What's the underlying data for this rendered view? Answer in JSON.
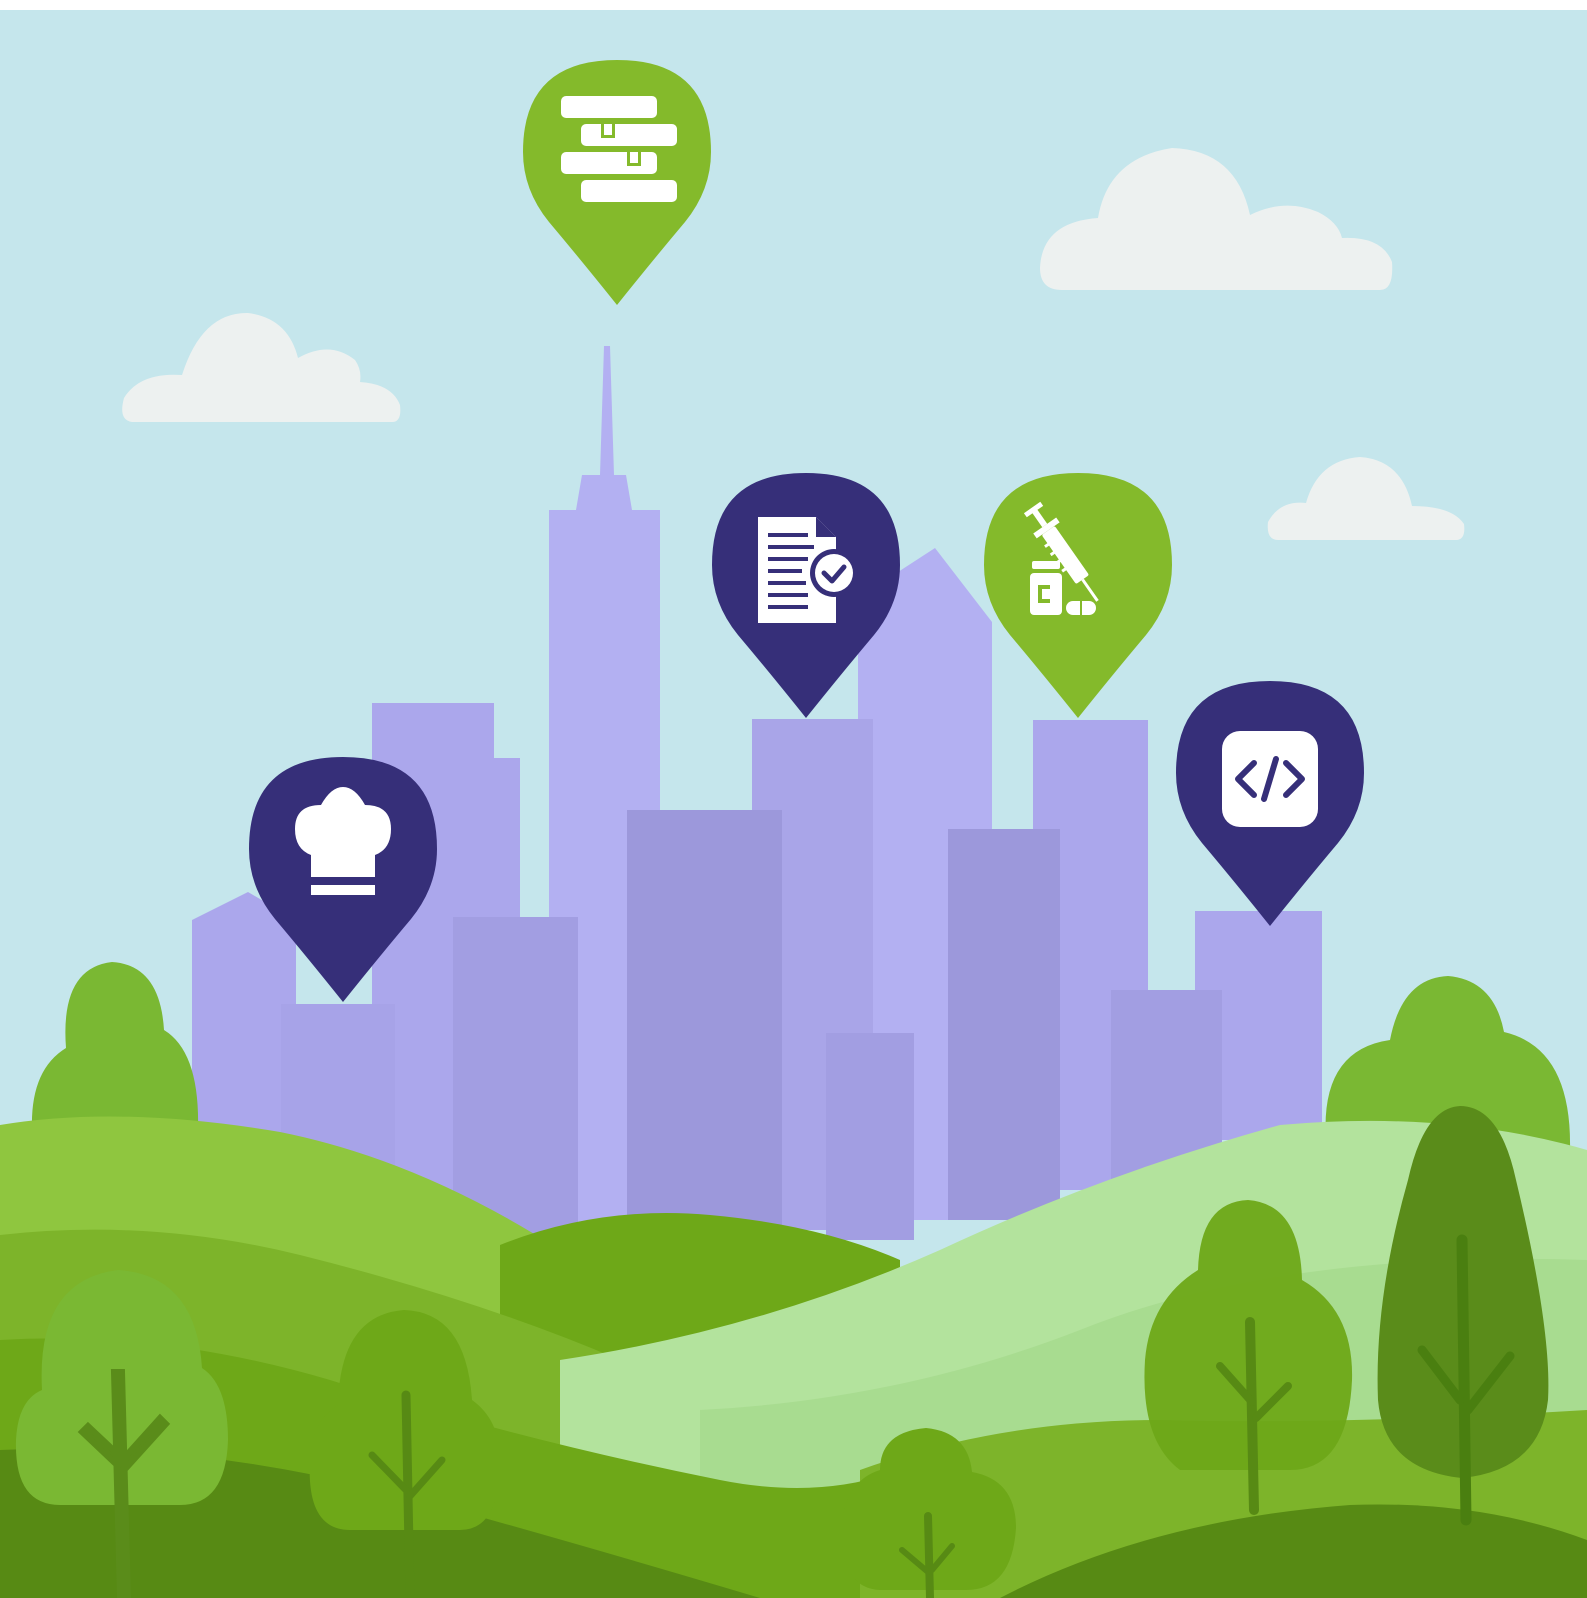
{
  "scene": {
    "colors": {
      "sky": "#c5e6ec",
      "cloud": "#edf1f0",
      "building_light": "#b3b0f2",
      "building_mid": "#a9a5e8",
      "building_dark": "#9b97d8",
      "hill_light": "#b3e39d",
      "hill_mid": "#8cc63e",
      "hill_dark": "#6ea818",
      "hill_deep": "#578a14",
      "tree_light": "#7ab833",
      "tree_dark": "#5a8c1a",
      "trunk": "#4a7f10",
      "pin_green": "#84ba2b",
      "pin_navy": "#362f79",
      "icon_white": "#ffffff"
    },
    "pins": [
      {
        "color": "green",
        "icon": "books-icon"
      },
      {
        "color": "navy",
        "icon": "document-check-icon"
      },
      {
        "color": "green",
        "icon": "syringe-medicine-icon"
      },
      {
        "color": "navy",
        "icon": "chef-hat-icon"
      },
      {
        "color": "navy",
        "icon": "code-icon"
      }
    ]
  }
}
